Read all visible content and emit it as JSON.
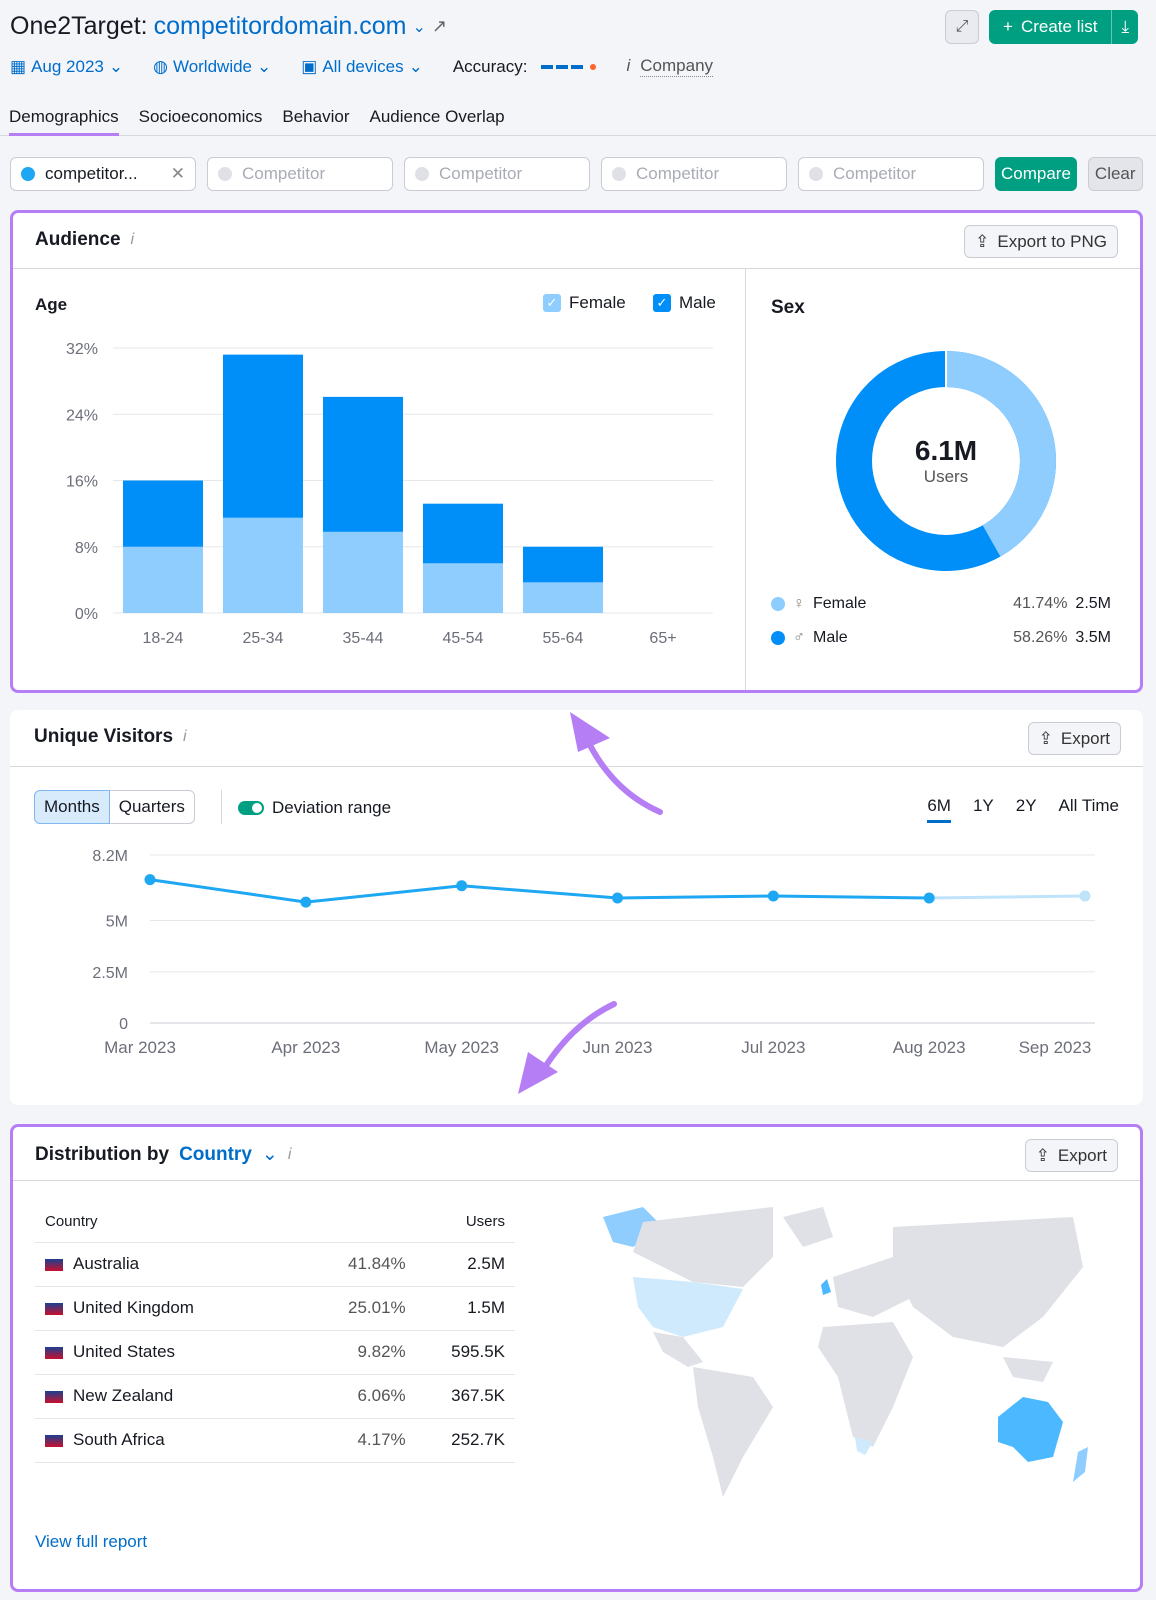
{
  "header": {
    "app": "One2Target:",
    "domain": "competitordomain.com"
  },
  "actions": {
    "create_list": "Create list"
  },
  "filters": {
    "date": "Aug 2023",
    "region": "Worldwide",
    "devices": "All devices",
    "accuracy_label": "Accuracy:",
    "company": "Company"
  },
  "tabs": [
    "Demographics",
    "Socioeconomics",
    "Behavior",
    "Audience Overlap"
  ],
  "compare": {
    "first": "competitor...",
    "placeholder": "Competitor",
    "compare": "Compare",
    "clear": "Clear"
  },
  "audience": {
    "title": "Audience",
    "export": "Export to PNG",
    "age_title": "Age",
    "legend_female": "Female",
    "legend_male": "Male",
    "sex_title": "Sex",
    "total": "6.1M",
    "total_label": "Users",
    "sex": [
      {
        "label": "Female",
        "pct": "41.74%",
        "users": "2.5M",
        "color": "#8fcdff"
      },
      {
        "label": "Male",
        "pct": "58.26%",
        "users": "3.5M",
        "color": "#008ff8"
      }
    ]
  },
  "chart_data": [
    {
      "type": "bar",
      "stacked": true,
      "categories": [
        "18-24",
        "25-34",
        "35-44",
        "45-54",
        "55-64",
        "65+"
      ],
      "series": [
        {
          "name": "Female",
          "values": [
            8,
            11.5,
            9.8,
            6,
            3.7,
            0
          ],
          "color": "#8fcdff"
        },
        {
          "name": "Male",
          "values": [
            8,
            19.7,
            16.3,
            7.2,
            4.3,
            0
          ],
          "color": "#008ff8"
        }
      ],
      "yticks": [
        "0%",
        "8%",
        "16%",
        "24%",
        "32%"
      ],
      "ylim": [
        0,
        32
      ],
      "grid": true
    },
    {
      "type": "line",
      "categories": [
        "Mar 2023",
        "Apr 2023",
        "May 2023",
        "Jun 2023",
        "Jul 2023",
        "Aug 2023",
        "Sep 2023"
      ],
      "values": [
        7.0,
        5.9,
        6.7,
        6.1,
        6.2,
        6.1,
        6.2
      ],
      "yticks": [
        {
          "v": 0,
          "l": "0"
        },
        {
          "v": 2.5,
          "l": "2.5M"
        },
        {
          "v": 5,
          "l": "5M"
        },
        {
          "v": 8.2,
          "l": "8.2M"
        }
      ],
      "ylim": [
        0,
        8.2
      ],
      "color": "#1ea7f2",
      "forecast_color": "#bfe3fb",
      "grid": true
    }
  ],
  "visitors": {
    "title": "Unique Visitors",
    "export": "Export",
    "months": "Months",
    "quarters": "Quarters",
    "deviation": "Deviation range",
    "ranges": [
      "6M",
      "1Y",
      "2Y",
      "All Time"
    ],
    "active_range": "6M"
  },
  "country": {
    "title": "Distribution by",
    "dropdown": "Country",
    "export": "Export",
    "col_country": "Country",
    "col_users": "Users",
    "rows": [
      {
        "name": "Australia",
        "pct": "41.84%",
        "users": "2.5M"
      },
      {
        "name": "United Kingdom",
        "pct": "25.01%",
        "users": "1.5M"
      },
      {
        "name": "United States",
        "pct": "9.82%",
        "users": "595.5K"
      },
      {
        "name": "New Zealand",
        "pct": "6.06%",
        "users": "367.5K"
      },
      {
        "name": "South Africa",
        "pct": "4.17%",
        "users": "252.7K"
      }
    ],
    "view_full": "View full report"
  }
}
